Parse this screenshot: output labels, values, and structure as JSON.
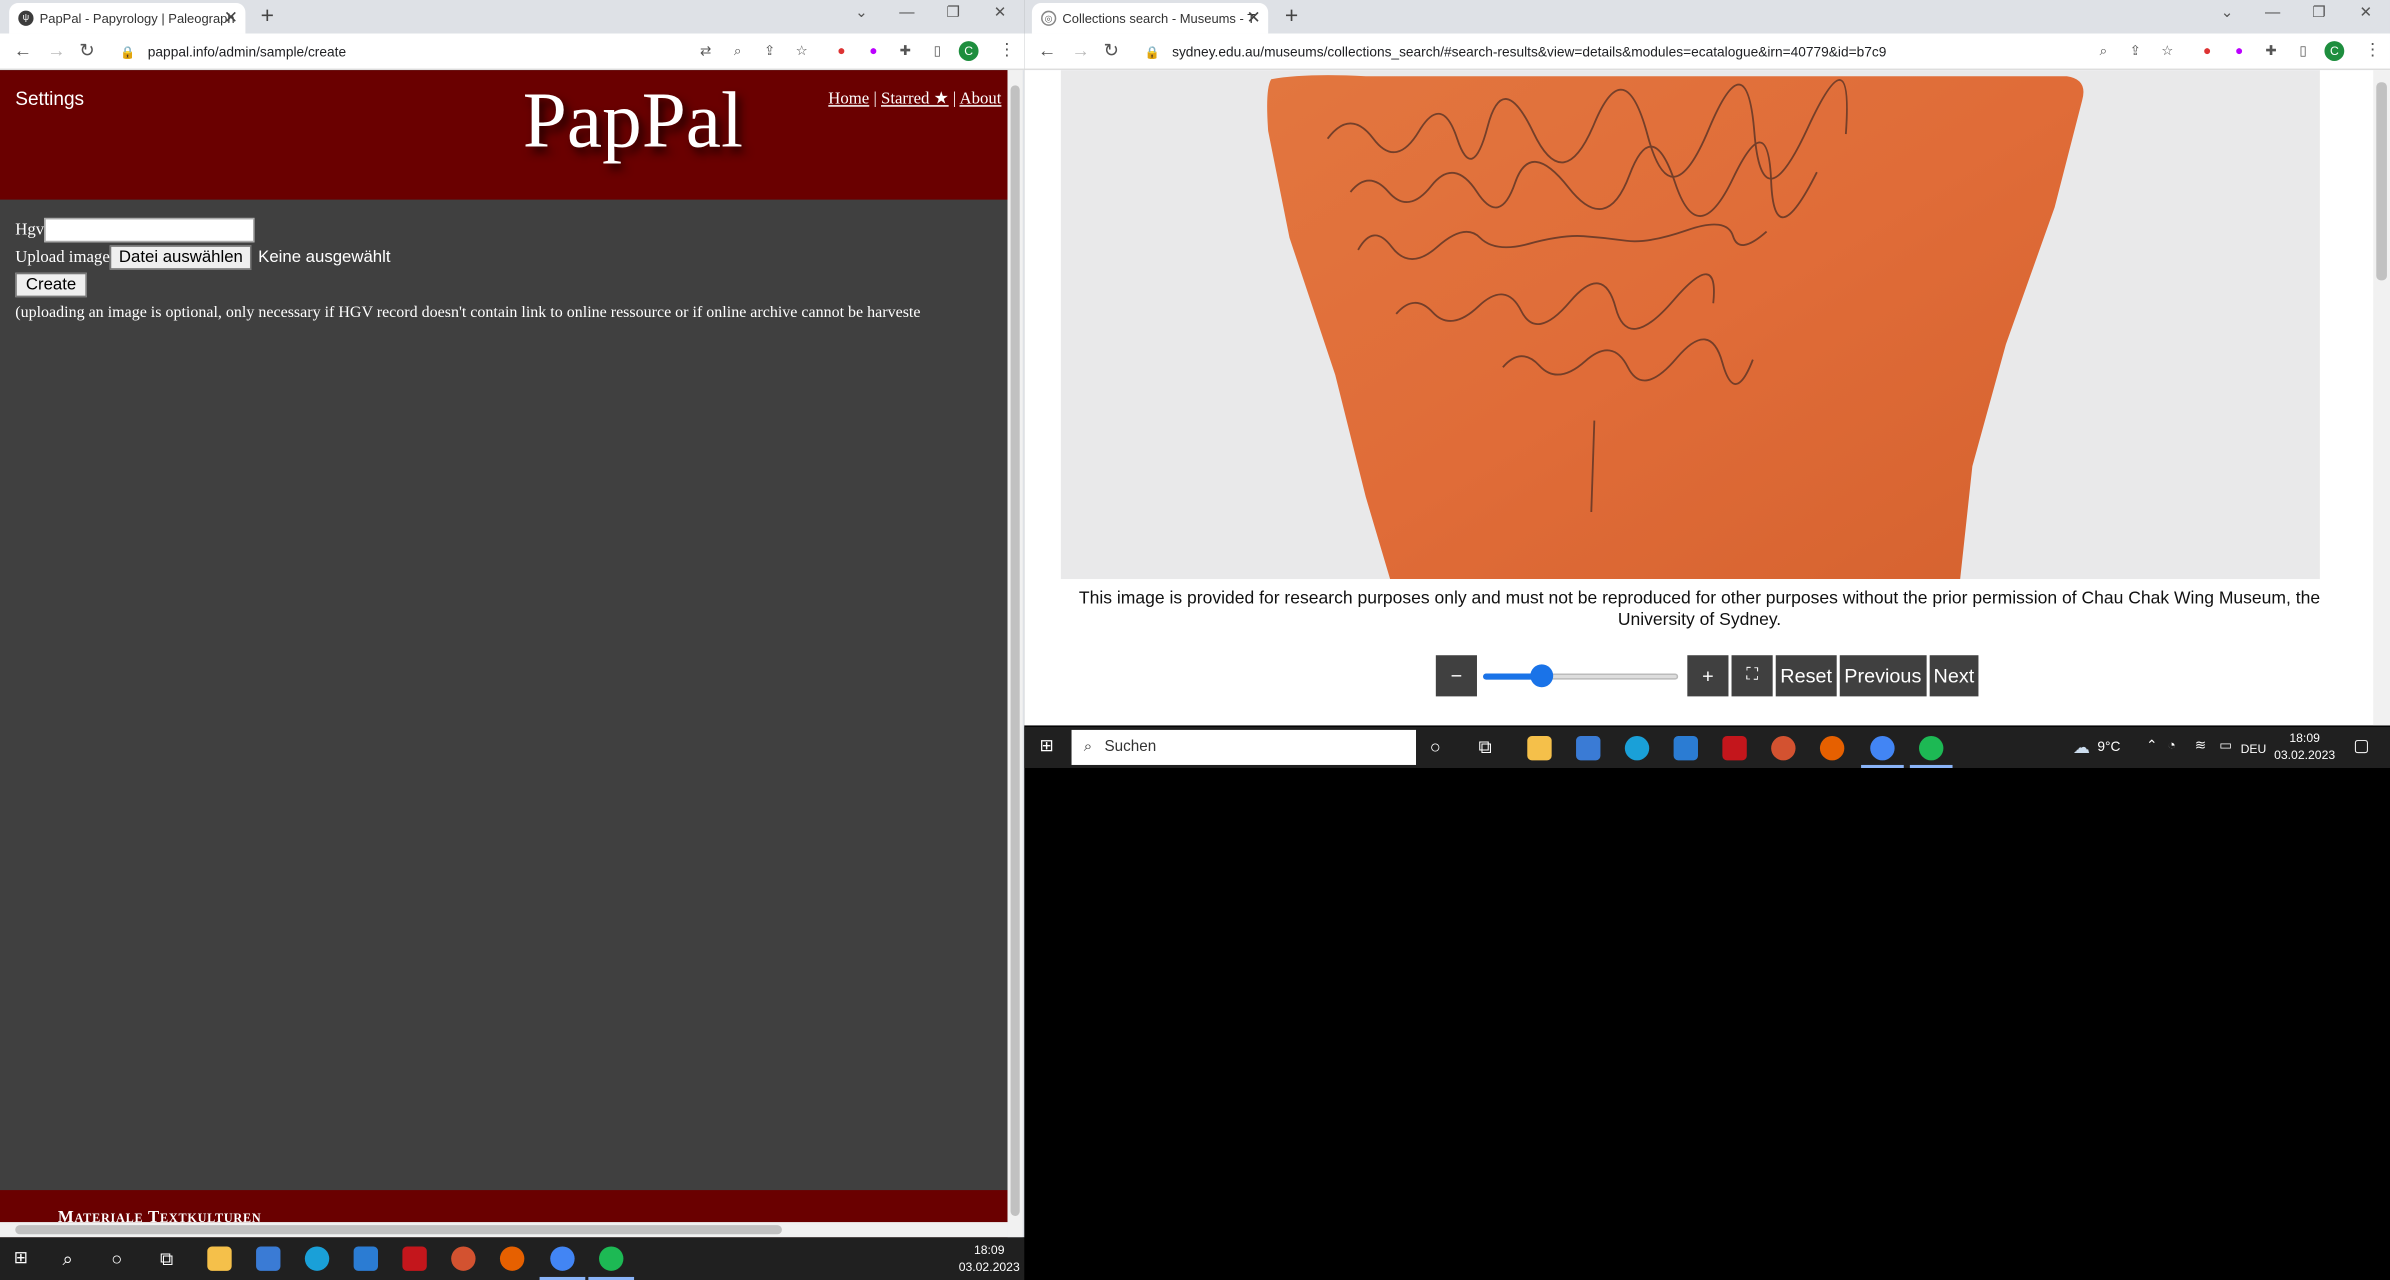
{
  "left_window": {
    "tab_title": "PapPal - Papyrology | Paleograph",
    "url": "pappal.info/admin/sample/create",
    "page": {
      "settings_label": "Settings",
      "logo": "PapPal",
      "links": [
        "Home",
        "Starred ★",
        "About"
      ],
      "link_separator": "|",
      "hgv_label": "Hgv",
      "hgv_value": "",
      "upload_label": "Upload image",
      "file_button": "Datei auswählen",
      "no_file": "Keine ausgewählt",
      "create_button": "Create",
      "note": "(uploading an image is optional, only necessary if HGV record doesn't contain link to online ressource or if online archive cannot be harveste",
      "footer_text": "Materiale Textkulturen"
    }
  },
  "right_window": {
    "tab_title": "Collections search - Museums - T",
    "url": "sydney.edu.au/museums/collections_search/#search-results&view=details&modules=ecatalogue&irn=40779&id=b7c9",
    "caption": "This image is provided for research purposes only and must not be reproduced for other purposes without the prior permission of Chau Chak Wing Museum, the University of Sydney.",
    "viewer": {
      "zoom_out": "−",
      "zoom_in": "+",
      "fullscreen": "⛶",
      "reset": "Reset",
      "previous": "Previous",
      "next": "Next",
      "zoom_level": 0.27
    }
  },
  "taskbar_small": {
    "search_placeholder": "Suchen",
    "weather": "9°C",
    "language": "DEU",
    "time": "18:09",
    "date": "03.02.2023"
  },
  "taskbar_main": {
    "time": "18:09",
    "date": "03.02.2023"
  },
  "colors": {
    "pappal_header": "#6a0000",
    "pappal_body": "#404040",
    "slider_accent": "#1a73e8",
    "taskbar": "#202020"
  }
}
